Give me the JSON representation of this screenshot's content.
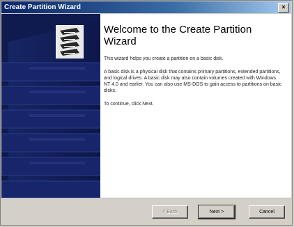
{
  "window": {
    "title": "Create Partition Wizard",
    "close_symbol": "×"
  },
  "main": {
    "title": "Welcome to the Create Partition Wizard",
    "intro": "This wizard helps you create a partition on a basic disk.",
    "description": "A basic disk is a physical disk that contains primary partitions, extended partitions, and logical drives. A basic disk may also contain volumes created with Windows NT 4.0 and earlier. You can also use MS-DOS to gain access to partitions on basic disks.",
    "continue_text": "To continue, click Next."
  },
  "buttons": {
    "back": "< Back",
    "next": "Next >",
    "cancel": "Cancel"
  },
  "colors": {
    "sidebar": "#0f1b4f",
    "titlebar": "#0a246a",
    "face": "#d4d0c8"
  },
  "icons": [
    "disk-stack-icon",
    "server-rack-graphic"
  ]
}
